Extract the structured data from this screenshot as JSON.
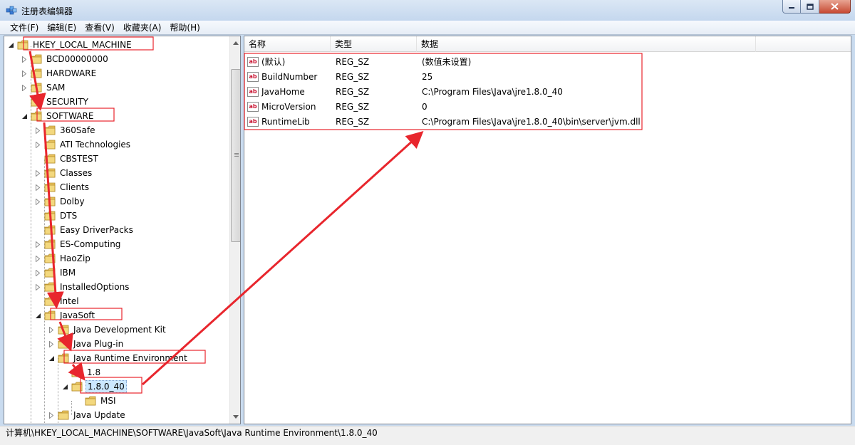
{
  "window": {
    "title": "注册表编辑器"
  },
  "menu": [
    "文件(F)",
    "编辑(E)",
    "查看(V)",
    "收藏夹(A)",
    "帮助(H)"
  ],
  "tree": [
    {
      "label": "HKEY_LOCAL_MACHINE",
      "level": 0,
      "expander": "expanded"
    },
    {
      "label": "BCD00000000",
      "level": 1,
      "expander": "collapsed"
    },
    {
      "label": "HARDWARE",
      "level": 1,
      "expander": "collapsed"
    },
    {
      "label": "SAM",
      "level": 1,
      "expander": "collapsed"
    },
    {
      "label": "SECURITY",
      "level": 1,
      "expander": "none"
    },
    {
      "label": "SOFTWARE",
      "level": 1,
      "expander": "expanded"
    },
    {
      "label": "360Safe",
      "level": 2,
      "expander": "collapsed"
    },
    {
      "label": "ATI Technologies",
      "level": 2,
      "expander": "collapsed"
    },
    {
      "label": "CBSTEST",
      "level": 2,
      "expander": "none"
    },
    {
      "label": "Classes",
      "level": 2,
      "expander": "collapsed"
    },
    {
      "label": "Clients",
      "level": 2,
      "expander": "collapsed"
    },
    {
      "label": "Dolby",
      "level": 2,
      "expander": "collapsed"
    },
    {
      "label": "DTS",
      "level": 2,
      "expander": "none"
    },
    {
      "label": "Easy DriverPacks",
      "level": 2,
      "expander": "none"
    },
    {
      "label": "ES-Computing",
      "level": 2,
      "expander": "collapsed"
    },
    {
      "label": "HaoZip",
      "level": 2,
      "expander": "collapsed"
    },
    {
      "label": "IBM",
      "level": 2,
      "expander": "collapsed"
    },
    {
      "label": "InstalledOptions",
      "level": 2,
      "expander": "collapsed"
    },
    {
      "label": "Intel",
      "level": 2,
      "expander": "none"
    },
    {
      "label": "JavaSoft",
      "level": 2,
      "expander": "expanded"
    },
    {
      "label": "Java Development Kit",
      "level": 3,
      "expander": "collapsed"
    },
    {
      "label": "Java Plug-in",
      "level": 3,
      "expander": "collapsed"
    },
    {
      "label": "Java Runtime Environment",
      "level": 3,
      "expander": "expanded"
    },
    {
      "label": "1.8",
      "level": 4,
      "expander": "none"
    },
    {
      "label": "1.8.0_40",
      "level": 4,
      "expander": "expanded",
      "selected": true
    },
    {
      "label": "MSI",
      "level": 5,
      "expander": "none"
    },
    {
      "label": "Java Update",
      "level": 3,
      "expander": "collapsed"
    }
  ],
  "list": {
    "columns": [
      "名称",
      "类型",
      "数据"
    ],
    "rows": [
      {
        "name": "(默认)",
        "type": "REG_SZ",
        "data": "(数值未设置)"
      },
      {
        "name": "BuildNumber",
        "type": "REG_SZ",
        "data": "25"
      },
      {
        "name": "JavaHome",
        "type": "REG_SZ",
        "data": "C:\\Program Files\\Java\\jre1.8.0_40"
      },
      {
        "name": "MicroVersion",
        "type": "REG_SZ",
        "data": "0"
      },
      {
        "name": "RuntimeLib",
        "type": "REG_SZ",
        "data": "C:\\Program Files\\Java\\jre1.8.0_40\\bin\\server\\jvm.dll"
      }
    ],
    "value_icon_text": "ab"
  },
  "status": {
    "path": "计算机\\HKEY_LOCAL_MACHINE\\SOFTWARE\\JavaSoft\\Java Runtime Environment\\1.8.0_40"
  },
  "colors": {
    "annotation": "#e8262d",
    "folder": "#e8c25c",
    "selection": "#cce8ff"
  }
}
